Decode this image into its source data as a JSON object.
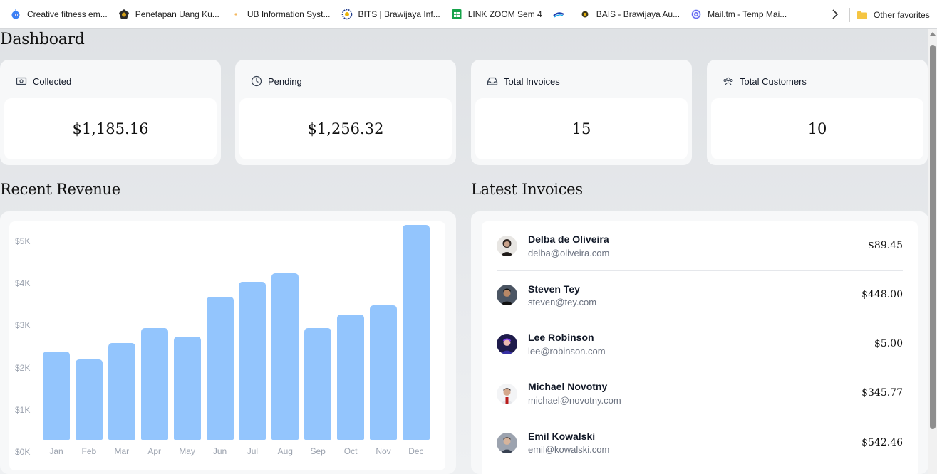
{
  "bookmarks": [
    {
      "label": "Creative fitness em...",
      "icon": "robot-icon"
    },
    {
      "label": "Penetapan Uang Ku...",
      "icon": "crest-icon"
    },
    {
      "label": "UB Information Syst...",
      "icon": "dot-icon"
    },
    {
      "label": "BITS | Brawijaya Inf...",
      "icon": "gear-emblem-icon"
    },
    {
      "label": "LINK ZOOM Sem 4",
      "icon": "sheets-icon"
    },
    {
      "label": "",
      "icon": "bsi-logo-icon"
    },
    {
      "label": "BAIS - Brawijaya Au...",
      "icon": "shield-icon"
    },
    {
      "label": "Mail.tm - Temp Mai...",
      "icon": "at-icon"
    }
  ],
  "other_favorites": "Other favorites",
  "page": {
    "title": "Dashboard"
  },
  "cards": [
    {
      "label": "Collected",
      "value": "$1,185.16",
      "icon": "banknotes-icon"
    },
    {
      "label": "Pending",
      "value": "$1,256.32",
      "icon": "clock-icon"
    },
    {
      "label": "Total Invoices",
      "value": "15",
      "icon": "inbox-icon"
    },
    {
      "label": "Total Customers",
      "value": "10",
      "icon": "user-group-icon"
    }
  ],
  "revenue": {
    "title": "Recent Revenue"
  },
  "chart_data": {
    "type": "bar",
    "title": "",
    "xlabel": "",
    "ylabel": "",
    "categories": [
      "Jan",
      "Feb",
      "Mar",
      "Apr",
      "May",
      "Jun",
      "Jul",
      "Aug",
      "Sep",
      "Oct",
      "Nov",
      "Dec"
    ],
    "values": [
      2100,
      1900,
      2300,
      2650,
      2450,
      3400,
      3750,
      3950,
      2650,
      2980,
      3190,
      5100
    ],
    "y_ticks": [
      "$0K",
      "$1K",
      "$2K",
      "$3K",
      "$4K",
      "$5K"
    ],
    "ylim": [
      0,
      5100
    ],
    "grid": false,
    "color": "#93c5fd"
  },
  "invoices": {
    "title": "Latest Invoices",
    "items": [
      {
        "name": "Delba de Oliveira",
        "email": "delba@oliveira.com",
        "amount": "$89.45"
      },
      {
        "name": "Steven Tey",
        "email": "steven@tey.com",
        "amount": "$448.00"
      },
      {
        "name": "Lee Robinson",
        "email": "lee@robinson.com",
        "amount": "$5.00"
      },
      {
        "name": "Michael Novotny",
        "email": "michael@novotny.com",
        "amount": "$345.77"
      },
      {
        "name": "Emil Kowalski",
        "email": "emil@kowalski.com",
        "amount": "$542.46"
      }
    ]
  }
}
